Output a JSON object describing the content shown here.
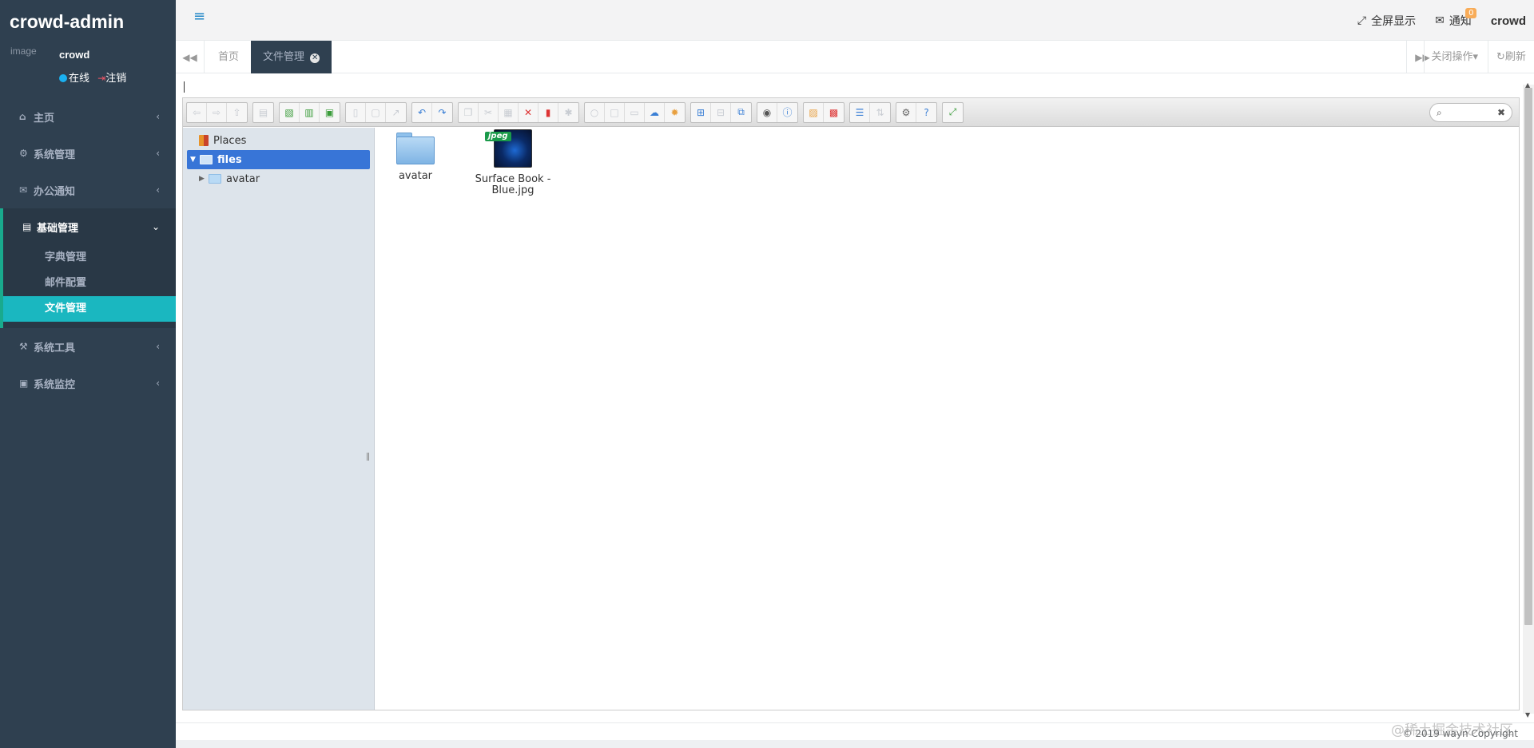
{
  "sidebar": {
    "brand": "crowd-admin",
    "user": {
      "avatar_alt": "image",
      "name": "crowd",
      "status": "在线",
      "logout": "注销"
    },
    "menu": [
      {
        "label": "主页",
        "icon": "home-icon"
      },
      {
        "label": "系统管理",
        "icon": "gear-icon"
      },
      {
        "label": "办公通知",
        "icon": "envelope-icon"
      },
      {
        "label": "基础管理",
        "icon": "id-card-icon",
        "expanded": true,
        "children": [
          {
            "label": "字典管理"
          },
          {
            "label": "邮件配置"
          },
          {
            "label": "文件管理",
            "active": true
          }
        ]
      },
      {
        "label": "系统工具",
        "icon": "wrench-icon"
      },
      {
        "label": "系统监控",
        "icon": "monitor-icon"
      }
    ]
  },
  "topbar": {
    "fullscreen": "全屏显示",
    "notify": "通知",
    "notify_count": "0",
    "username": "crowd"
  },
  "tabs": {
    "items": [
      {
        "label": "首页",
        "active": false
      },
      {
        "label": "文件管理",
        "active": true
      }
    ],
    "close_ops": "关闭操作",
    "refresh": "刷新"
  },
  "filemanager": {
    "tree": {
      "places": "Places",
      "root": "files",
      "children": [
        "avatar"
      ]
    },
    "files": [
      {
        "name": "avatar",
        "kind": "folder"
      },
      {
        "name": "Surface Book - Blue.jpg",
        "kind": "image",
        "badge": "jpeg"
      }
    ],
    "search_placeholder": ""
  },
  "footer": {
    "copyright": "© 2019 wayn Copyright",
    "watermark": "@稀土掘金技术社区"
  },
  "colors": {
    "sidebar_bg": "#2f4050",
    "accent": "#1ab7c0",
    "tree_selected": "#3875d7",
    "badge": "#f8ac59"
  }
}
